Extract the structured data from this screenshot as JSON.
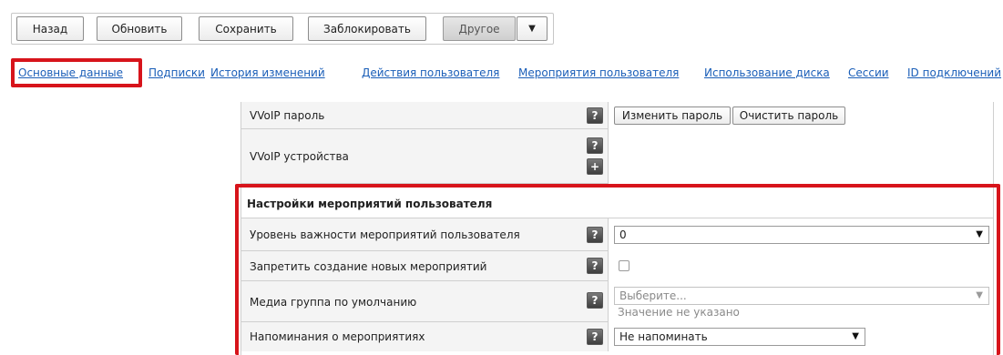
{
  "toolbar": {
    "back_label": "Назад",
    "refresh_label": "Обновить",
    "save_label": "Сохранить",
    "lock_label": "Заблокировать",
    "other_label": "Другое",
    "more_caret": "▼"
  },
  "tabs": [
    {
      "label": "Основные данные",
      "active": true
    },
    {
      "label": "Подписки"
    },
    {
      "label": "История изменений"
    },
    {
      "label": "Действия пользователя"
    },
    {
      "label": "Мероприятия пользователя"
    },
    {
      "label": "Использование диска"
    },
    {
      "label": "Сессии"
    },
    {
      "label": "ID подключений"
    }
  ],
  "form": {
    "vvoip_password": {
      "label": "VVoIP пароль",
      "help": "?",
      "change_label": "Изменить пароль",
      "clear_label": "Очистить пароль"
    },
    "vvoip_devices": {
      "label": "VVoIP устройства",
      "help": "?",
      "add": "+"
    },
    "section_title": "Настройки мероприятий пользователя",
    "importance": {
      "label": "Уровень важности мероприятий пользователя",
      "help": "?",
      "value": "0",
      "arrow": "▼"
    },
    "forbid_new": {
      "label": "Запретить создание новых мероприятий",
      "help": "?",
      "checked": false
    },
    "media_group": {
      "label": "Медиа группа по умолчанию",
      "help": "?",
      "placeholder": "Выберите...",
      "note": "Значение не указано",
      "arrow": "▼"
    },
    "reminders": {
      "label": "Напоминания о мероприятиях",
      "help": "?",
      "value": "Не напоминать",
      "arrow": "▼"
    }
  },
  "colors": {
    "link": "#1a5eb8",
    "highlight": "#d7141b",
    "row_bg": "#f4f4f4"
  }
}
